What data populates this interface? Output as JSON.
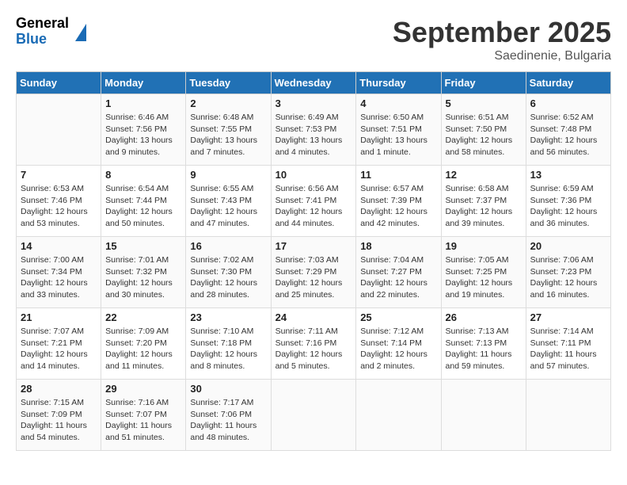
{
  "logo": {
    "general": "General",
    "blue": "Blue"
  },
  "header": {
    "month": "September 2025",
    "location": "Saedinenie, Bulgaria"
  },
  "weekdays": [
    "Sunday",
    "Monday",
    "Tuesday",
    "Wednesday",
    "Thursday",
    "Friday",
    "Saturday"
  ],
  "weeks": [
    [
      {
        "day": null
      },
      {
        "day": 1,
        "sunrise": "6:46 AM",
        "sunset": "7:56 PM",
        "daylight": "13 hours and 9 minutes."
      },
      {
        "day": 2,
        "sunrise": "6:48 AM",
        "sunset": "7:55 PM",
        "daylight": "13 hours and 7 minutes."
      },
      {
        "day": 3,
        "sunrise": "6:49 AM",
        "sunset": "7:53 PM",
        "daylight": "13 hours and 4 minutes."
      },
      {
        "day": 4,
        "sunrise": "6:50 AM",
        "sunset": "7:51 PM",
        "daylight": "13 hours and 1 minute."
      },
      {
        "day": 5,
        "sunrise": "6:51 AM",
        "sunset": "7:50 PM",
        "daylight": "12 hours and 58 minutes."
      },
      {
        "day": 6,
        "sunrise": "6:52 AM",
        "sunset": "7:48 PM",
        "daylight": "12 hours and 56 minutes."
      }
    ],
    [
      {
        "day": 7,
        "sunrise": "6:53 AM",
        "sunset": "7:46 PM",
        "daylight": "12 hours and 53 minutes."
      },
      {
        "day": 8,
        "sunrise": "6:54 AM",
        "sunset": "7:44 PM",
        "daylight": "12 hours and 50 minutes."
      },
      {
        "day": 9,
        "sunrise": "6:55 AM",
        "sunset": "7:43 PM",
        "daylight": "12 hours and 47 minutes."
      },
      {
        "day": 10,
        "sunrise": "6:56 AM",
        "sunset": "7:41 PM",
        "daylight": "12 hours and 44 minutes."
      },
      {
        "day": 11,
        "sunrise": "6:57 AM",
        "sunset": "7:39 PM",
        "daylight": "12 hours and 42 minutes."
      },
      {
        "day": 12,
        "sunrise": "6:58 AM",
        "sunset": "7:37 PM",
        "daylight": "12 hours and 39 minutes."
      },
      {
        "day": 13,
        "sunrise": "6:59 AM",
        "sunset": "7:36 PM",
        "daylight": "12 hours and 36 minutes."
      }
    ],
    [
      {
        "day": 14,
        "sunrise": "7:00 AM",
        "sunset": "7:34 PM",
        "daylight": "12 hours and 33 minutes."
      },
      {
        "day": 15,
        "sunrise": "7:01 AM",
        "sunset": "7:32 PM",
        "daylight": "12 hours and 30 minutes."
      },
      {
        "day": 16,
        "sunrise": "7:02 AM",
        "sunset": "7:30 PM",
        "daylight": "12 hours and 28 minutes."
      },
      {
        "day": 17,
        "sunrise": "7:03 AM",
        "sunset": "7:29 PM",
        "daylight": "12 hours and 25 minutes."
      },
      {
        "day": 18,
        "sunrise": "7:04 AM",
        "sunset": "7:27 PM",
        "daylight": "12 hours and 22 minutes."
      },
      {
        "day": 19,
        "sunrise": "7:05 AM",
        "sunset": "7:25 PM",
        "daylight": "12 hours and 19 minutes."
      },
      {
        "day": 20,
        "sunrise": "7:06 AM",
        "sunset": "7:23 PM",
        "daylight": "12 hours and 16 minutes."
      }
    ],
    [
      {
        "day": 21,
        "sunrise": "7:07 AM",
        "sunset": "7:21 PM",
        "daylight": "12 hours and 14 minutes."
      },
      {
        "day": 22,
        "sunrise": "7:09 AM",
        "sunset": "7:20 PM",
        "daylight": "12 hours and 11 minutes."
      },
      {
        "day": 23,
        "sunrise": "7:10 AM",
        "sunset": "7:18 PM",
        "daylight": "12 hours and 8 minutes."
      },
      {
        "day": 24,
        "sunrise": "7:11 AM",
        "sunset": "7:16 PM",
        "daylight": "12 hours and 5 minutes."
      },
      {
        "day": 25,
        "sunrise": "7:12 AM",
        "sunset": "7:14 PM",
        "daylight": "12 hours and 2 minutes."
      },
      {
        "day": 26,
        "sunrise": "7:13 AM",
        "sunset": "7:13 PM",
        "daylight": "11 hours and 59 minutes."
      },
      {
        "day": 27,
        "sunrise": "7:14 AM",
        "sunset": "7:11 PM",
        "daylight": "11 hours and 57 minutes."
      }
    ],
    [
      {
        "day": 28,
        "sunrise": "7:15 AM",
        "sunset": "7:09 PM",
        "daylight": "11 hours and 54 minutes."
      },
      {
        "day": 29,
        "sunrise": "7:16 AM",
        "sunset": "7:07 PM",
        "daylight": "11 hours and 51 minutes."
      },
      {
        "day": 30,
        "sunrise": "7:17 AM",
        "sunset": "7:06 PM",
        "daylight": "11 hours and 48 minutes."
      },
      {
        "day": null
      },
      {
        "day": null
      },
      {
        "day": null
      },
      {
        "day": null
      }
    ]
  ]
}
